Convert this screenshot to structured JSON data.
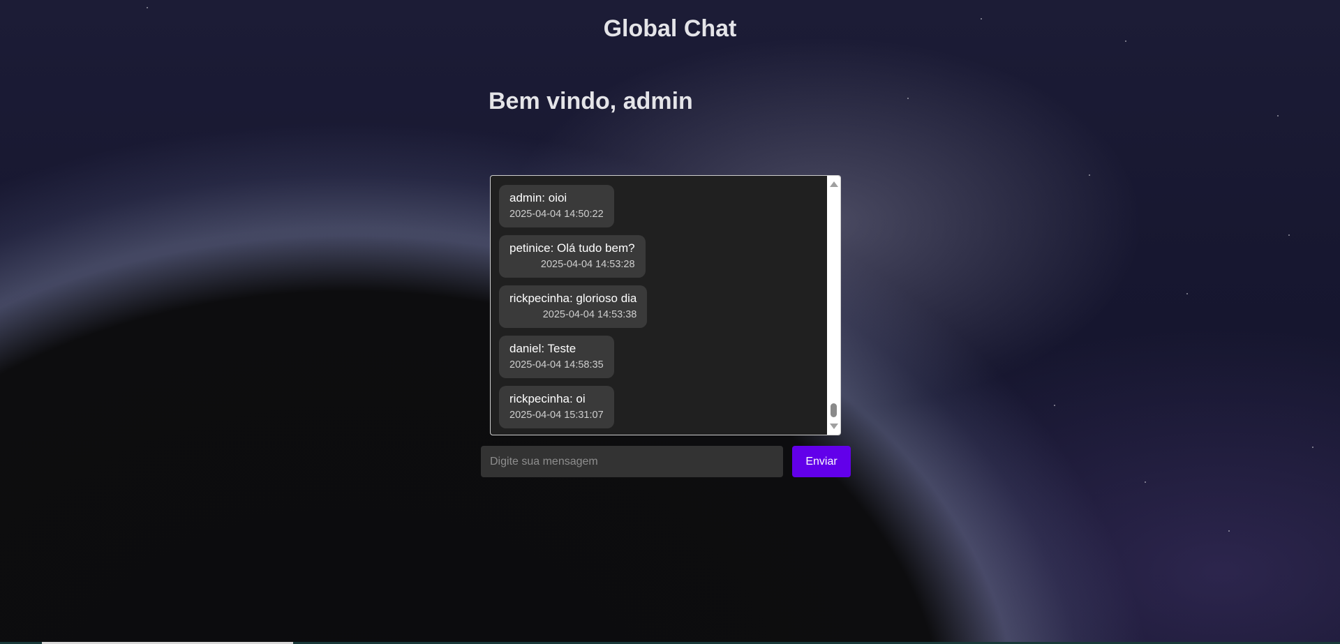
{
  "header": {
    "title": "Global Chat"
  },
  "welcome": {
    "text": "Bem vindo, admin"
  },
  "messages": [
    {
      "text": "admin: oioi",
      "time": "2025-04-04 14:50:22"
    },
    {
      "text": "petinice: Olá tudo bem?",
      "time": "2025-04-04 14:53:28"
    },
    {
      "text": "rickpecinha: glorioso dia",
      "time": "2025-04-04 14:53:38"
    },
    {
      "text": "daniel: Teste",
      "time": "2025-04-04 14:58:35"
    },
    {
      "text": "rickpecinha: oi",
      "time": "2025-04-04 15:31:07"
    }
  ],
  "composer": {
    "placeholder": "Digite sua mensagem",
    "value": "",
    "send_label": "Enviar"
  },
  "colors": {
    "accent": "#6200ea",
    "bubble": "#3a3a3a",
    "chat_background": "#202020"
  }
}
